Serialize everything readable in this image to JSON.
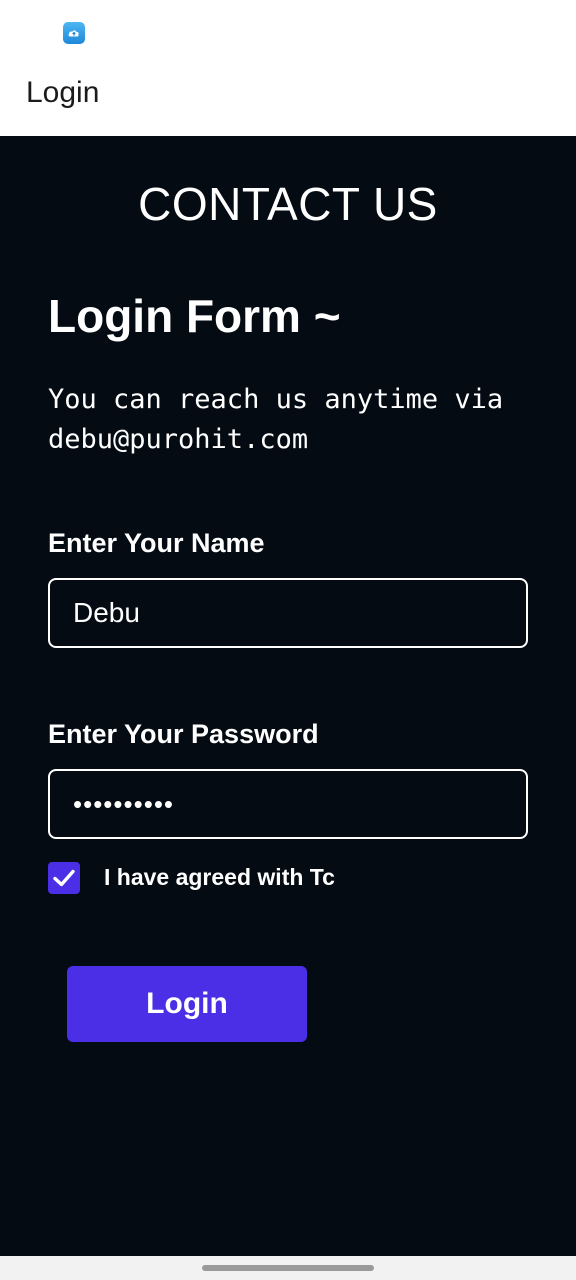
{
  "status_bar": {
    "app_icon": "cloud-upload-icon"
  },
  "app_bar": {
    "title": "Login"
  },
  "page": {
    "heading": "CONTACT US",
    "form_title": "Login Form ~",
    "contact_info": "You can reach us anytime via\ndebu@purohit.com"
  },
  "form": {
    "name_label": "Enter Your Name",
    "name_value": "Debu",
    "password_label": "Enter Your Password",
    "password_value": "••••••••••",
    "checkbox_checked": true,
    "checkbox_label": "I have agreed with Tc",
    "submit_label": "Login"
  },
  "colors": {
    "background": "#050b13",
    "accent": "#4a2fe6",
    "app_bar": "#ffffff"
  }
}
